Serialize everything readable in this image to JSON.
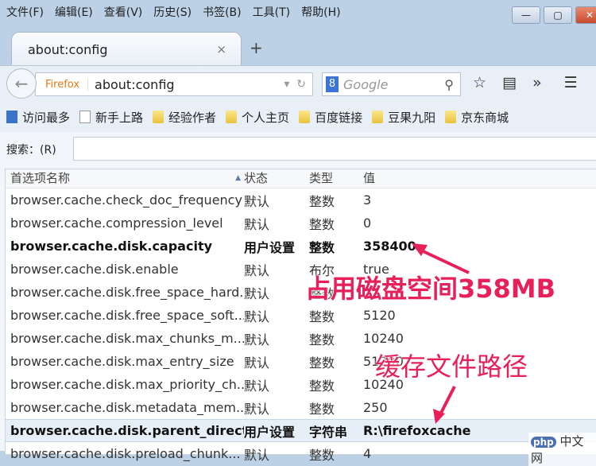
{
  "menu": [
    "文件(F)",
    "编辑(E)",
    "查看(V)",
    "历史(S)",
    "书签(B)",
    "工具(T)",
    "帮助(H)"
  ],
  "window_buttons": {
    "minimize": "—",
    "maximize": "▢",
    "close": "✕"
  },
  "tab": {
    "title": "about:config",
    "close": "×",
    "new": "+"
  },
  "nav": {
    "identity": "Firefox",
    "url": "about:config",
    "search_engine": "8",
    "search_placeholder": "Google"
  },
  "bookmarks": [
    "访问最多",
    "新手上路",
    "经验作者",
    "个人主页",
    "百度链接",
    "豆果九阳",
    "京东商城"
  ],
  "search": {
    "label": "搜索：(R)",
    "value": ""
  },
  "table": {
    "headers": [
      "首选项名称",
      "状态",
      "类型",
      "值"
    ],
    "rows": [
      {
        "name": "browser.cache.check_doc_frequency",
        "status": "默认",
        "type": "整数",
        "value": "3"
      },
      {
        "name": "browser.cache.compression_level",
        "status": "默认",
        "type": "整数",
        "value": "0"
      },
      {
        "name": "browser.cache.disk.capacity",
        "status": "用户设置",
        "type": "整数",
        "value": "358400"
      },
      {
        "name": "browser.cache.disk.enable",
        "status": "默认",
        "type": "布尔",
        "value": "true"
      },
      {
        "name": "browser.cache.disk.free_space_hard...",
        "status": "默认",
        "type": "整数",
        "value": ""
      },
      {
        "name": "browser.cache.disk.free_space_soft...",
        "status": "默认",
        "type": "整数",
        "value": "5120"
      },
      {
        "name": "browser.cache.disk.max_chunks_m...",
        "status": "默认",
        "type": "整数",
        "value": "10240"
      },
      {
        "name": "browser.cache.disk.max_entry_size",
        "status": "默认",
        "type": "整数",
        "value": "51200"
      },
      {
        "name": "browser.cache.disk.max_priority_ch...",
        "status": "默认",
        "type": "整数",
        "value": "10240"
      },
      {
        "name": "browser.cache.disk.metadata_mem...",
        "status": "默认",
        "type": "整数",
        "value": "250"
      },
      {
        "name": "browser.cache.disk.parent_direct...",
        "status": "用户设置",
        "type": "字符串",
        "value": "R:\\firefoxcache"
      },
      {
        "name": "browser.cache.disk.preload_chunk...",
        "status": "默认",
        "type": "整数",
        "value": "4"
      }
    ]
  },
  "annotations": {
    "capacity": "占用磁盘空间358MB",
    "path": "缓存文件路径"
  },
  "watermark": {
    "logo": "php",
    "text": "中文网"
  },
  "colors": {
    "annotation": "#e8205a"
  }
}
